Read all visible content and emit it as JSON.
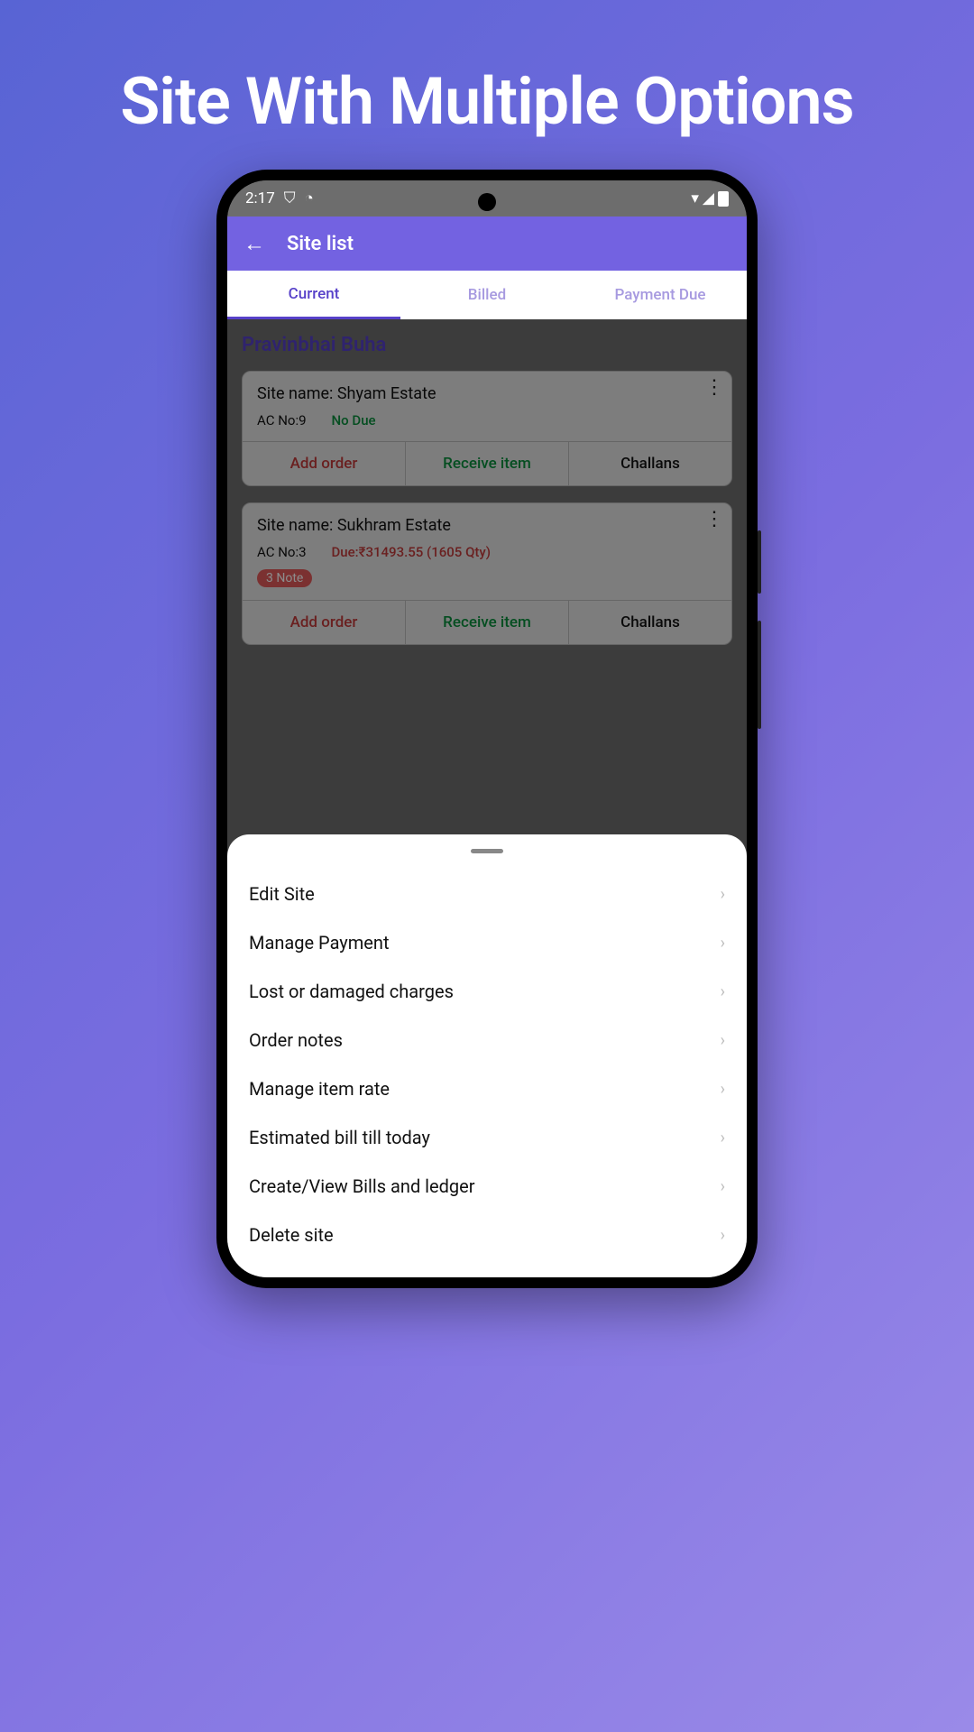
{
  "hero": "Site With Multiple Options",
  "status": {
    "time": "2:17"
  },
  "appbar": {
    "title": "Site list"
  },
  "tabs": {
    "current": "Current",
    "billed": "Billed",
    "payment_due": "Payment Due"
  },
  "customer": "Pravinbhai Buha",
  "sites": [
    {
      "name_label": "Site name: Shyam Estate",
      "ac": "AC No:9",
      "due": "No Due",
      "due_type": "none"
    },
    {
      "name_label": "Site name: Sukhram Estate",
      "ac": "AC No:3",
      "due": "Due:₹31493.55 (1605 Qty)",
      "due_type": "owed",
      "note": "3 Note"
    }
  ],
  "actions": {
    "add_order": "Add order",
    "receive_item": "Receive item",
    "challans": "Challans"
  },
  "sheet": {
    "items": [
      "Edit Site",
      "Manage Payment",
      "Lost or damaged charges",
      "Order notes",
      "Manage item rate",
      "Estimated bill till today",
      "Create/View Bills and ledger",
      "Delete site"
    ]
  }
}
